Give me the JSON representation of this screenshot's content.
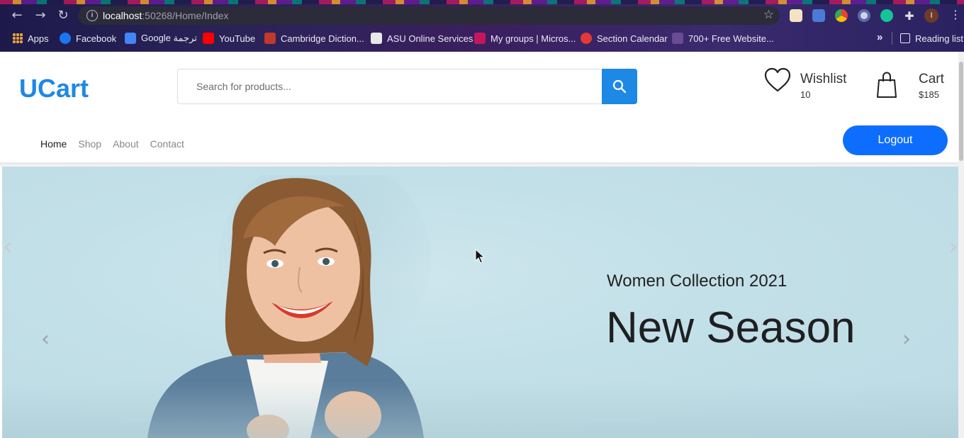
{
  "browser": {
    "url_host": "localhost",
    "url_path": ":50268/Home/Index",
    "bookmarks": [
      {
        "label": "Apps",
        "icon": "apps-grid-icon"
      },
      {
        "label": "Facebook",
        "icon": "facebook-icon",
        "color": "#1877f2"
      },
      {
        "label": "Google ترجمة",
        "icon": "google-translate-icon",
        "color": "#4285f4"
      },
      {
        "label": "YouTube",
        "icon": "youtube-icon",
        "color": "#ff0000"
      },
      {
        "label": "Cambridge Diction...",
        "icon": "cambridge-icon",
        "color": "#c0392b"
      },
      {
        "label": "ASU Online Services",
        "icon": "asu-icon",
        "color": "#e8e8e8"
      },
      {
        "label": "My groups | Micros...",
        "icon": "ms-groups-icon",
        "color": "#c2185b"
      },
      {
        "label": "Section Calendar",
        "icon": "section-calendar-icon",
        "color": "#e53935"
      },
      {
        "label": "700+ Free Website...",
        "icon": "colorlib-icon",
        "color": "#6a4c93"
      }
    ],
    "reading_list": "Reading list",
    "profile_initial": "I"
  },
  "header": {
    "logo": "UCart",
    "search_placeholder": "Search for products...",
    "wishlist_label": "Wishlist",
    "wishlist_count": "10",
    "cart_label": "Cart",
    "cart_total": "$185",
    "logout_label": "Logout",
    "accent": "#1e88e5"
  },
  "nav": [
    {
      "label": "Home",
      "active": true
    },
    {
      "label": "Shop",
      "active": false
    },
    {
      "label": "About",
      "active": false
    },
    {
      "label": "Contact",
      "active": false
    }
  ],
  "hero": {
    "subtitle": "Women Collection 2021",
    "title": "New Season"
  }
}
